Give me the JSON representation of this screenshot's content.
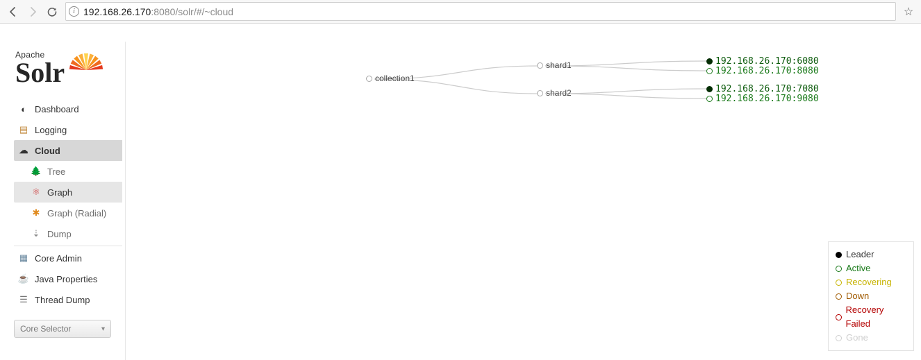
{
  "browser": {
    "url_host": "192.168.26.170",
    "url_port": ":8080",
    "url_path": "/solr/#/~cloud"
  },
  "logo": {
    "apache": "Apache",
    "solr": "Solr"
  },
  "nav": {
    "dashboard": "Dashboard",
    "logging": "Logging",
    "cloud": "Cloud",
    "cloud_sub": {
      "tree": "Tree",
      "graph": "Graph",
      "graph_radial": "Graph (Radial)",
      "dump": "Dump"
    },
    "core_admin": "Core Admin",
    "java_props": "Java Properties",
    "thread_dump": "Thread Dump"
  },
  "core_selector": {
    "label": "Core Selector"
  },
  "graph": {
    "collection": "collection1",
    "shards": [
      {
        "name": "shard1",
        "replicas": [
          {
            "addr": "192.168.26.170:6080",
            "state": "leader"
          },
          {
            "addr": "192.168.26.170:8080",
            "state": "active"
          }
        ]
      },
      {
        "name": "shard2",
        "replicas": [
          {
            "addr": "192.168.26.170:7080",
            "state": "leader"
          },
          {
            "addr": "192.168.26.170:9080",
            "state": "active"
          }
        ]
      }
    ]
  },
  "legend": {
    "leader": "Leader",
    "active": "Active",
    "recovering": "Recovering",
    "down": "Down",
    "failed": "Recovery Failed",
    "gone": "Gone"
  }
}
